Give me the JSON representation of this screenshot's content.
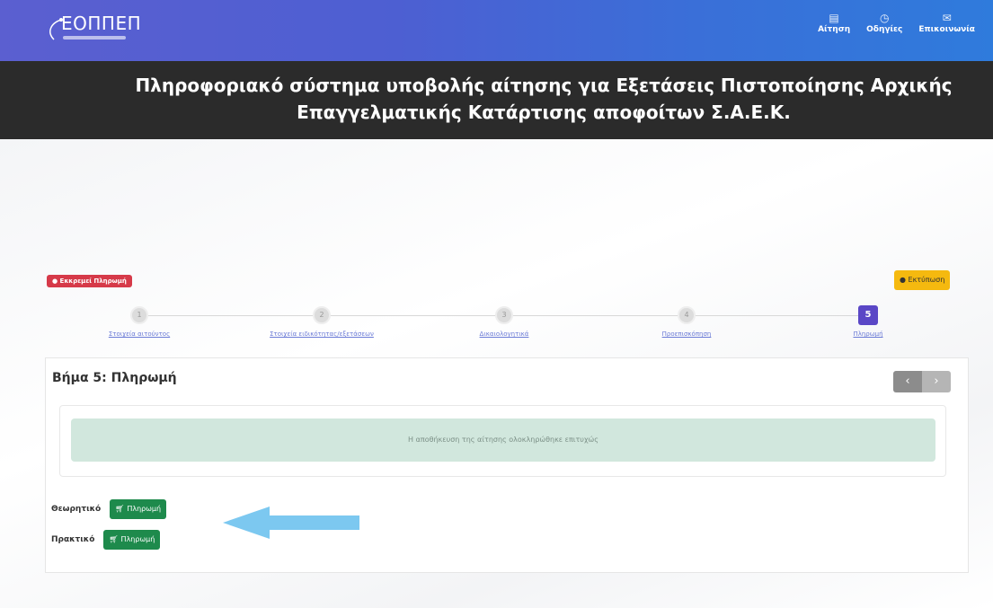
{
  "navbar": {
    "logo_text": "ΕΟΠΠΕΠ",
    "links": [
      {
        "icon": "document-icon",
        "label": "Αίτηση"
      },
      {
        "icon": "clock-icon",
        "label": "Οδηγίες"
      },
      {
        "icon": "envelope-icon",
        "label": "Επικοινωνία"
      }
    ]
  },
  "header": {
    "title_line1": "Πληροφοριακό σύστημα υποβολής αίτησης για Εξετάσεις Πιστοποίησης Αρχικής",
    "title_line2": "Επαγγελματικής Κατάρτισης αποφοίτων Σ.Α.Ε.Κ."
  },
  "badges": {
    "left": "Εκκρεμεί Πληρωμή",
    "right": "Εκτύπωση"
  },
  "stepper": {
    "steps": [
      {
        "number": "1",
        "label": "Στοιχεία αιτούντος"
      },
      {
        "number": "2",
        "label": "Στοιχεία ειδικότητας/εξετάσεων"
      },
      {
        "number": "3",
        "label": "Δικαιολογητικά"
      },
      {
        "number": "4",
        "label": "Προεπισκόπηση"
      },
      {
        "number": "5",
        "label": "Πληρωμή"
      }
    ],
    "active_step": 5
  },
  "card": {
    "title": "Βήμα 5: Πληρωμή",
    "prev_icon": "chevron-left-icon",
    "next_icon": "chevron-right-icon",
    "alert_text": "Η αποθήκευση της αίτησης ολοκληρώθηκε επιτυχώς"
  },
  "payments": {
    "theory_label": "Θεωρητικό",
    "practical_label": "Πρακτικό",
    "button_label": "Πληρωμή",
    "button_icon": "cart-icon"
  },
  "colors": {
    "accent": "#5a47c6",
    "pay_button": "#1e8a4c",
    "alert_bg": "#d1e7dd",
    "badge_red": "#d63a49",
    "badge_yellow": "#f5b90f",
    "arrow": "#6ec2ee"
  }
}
